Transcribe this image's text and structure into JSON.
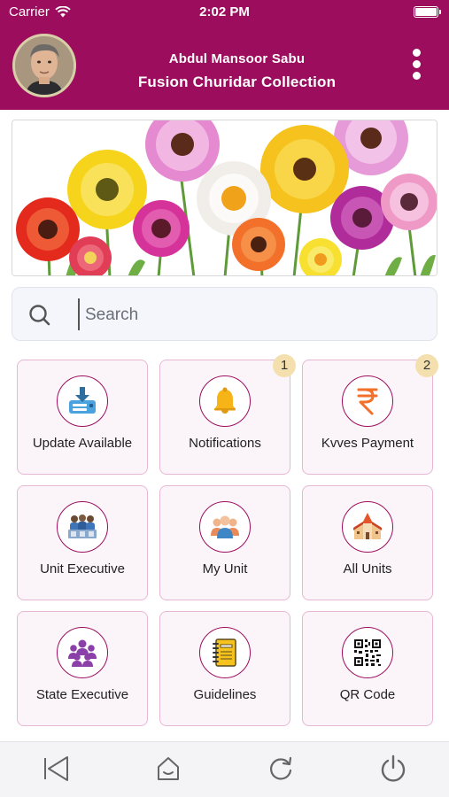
{
  "status_bar": {
    "carrier": "Carrier",
    "time": "2:02 PM"
  },
  "header": {
    "name": "Abdul Mansoor Sabu",
    "shop": "Fusion Churidar Collection",
    "background": "#9c0d5e",
    "menu_icon": "more-vertical-icon"
  },
  "search": {
    "placeholder": "Search"
  },
  "tiles": [
    {
      "label": "Update Available",
      "icon": "download-update-icon"
    },
    {
      "label": "Notifications",
      "icon": "bell-icon",
      "badge": "1"
    },
    {
      "label": "Kvves Payment",
      "icon": "rupee-icon",
      "badge": "2"
    },
    {
      "label": "Unit Executive",
      "icon": "group-icon"
    },
    {
      "label": "My Unit",
      "icon": "team-icon"
    },
    {
      "label": "All Units",
      "icon": "building-icon"
    },
    {
      "label": "State Executive",
      "icon": "people-icon"
    },
    {
      "label": "Guidelines",
      "icon": "notebook-icon"
    },
    {
      "label": "QR Code",
      "icon": "qr-code-icon"
    }
  ],
  "bottom_nav": [
    "back-icon",
    "home-icon",
    "refresh-icon",
    "power-icon"
  ],
  "colors": {
    "accent": "#9c0d5e",
    "tile_background": "#fbf5fa",
    "tile_border": "#e7b7d4",
    "badge": "#f4dfae"
  }
}
